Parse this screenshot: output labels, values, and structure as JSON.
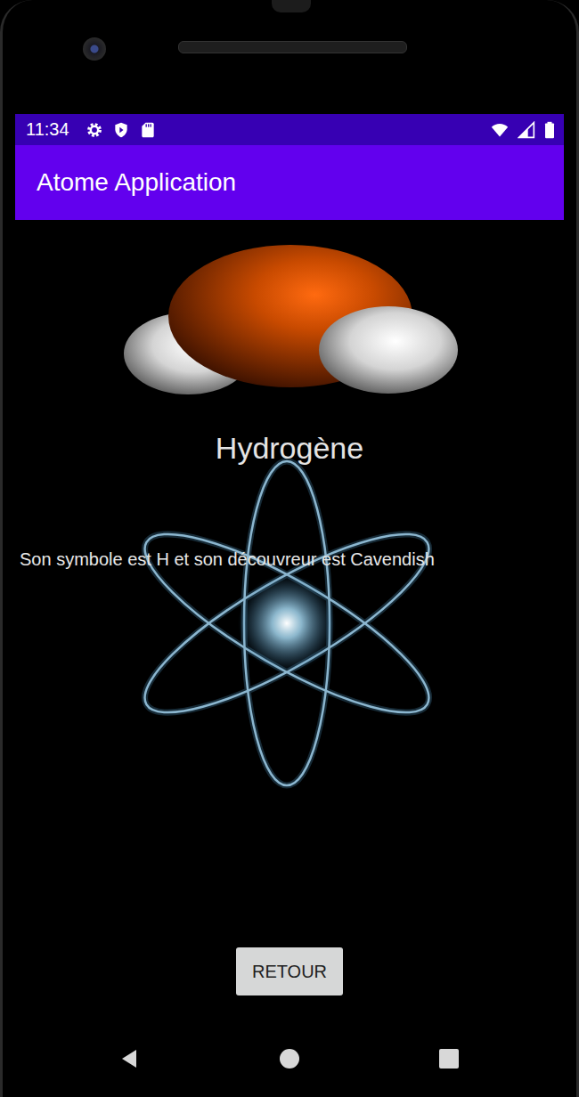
{
  "status_bar": {
    "time": "11:34"
  },
  "app_bar": {
    "title": "Atome Application"
  },
  "element": {
    "name": "Hydrogène",
    "description": "Son symbole est H et son découvreur est Cavendish"
  },
  "buttons": [
    "RETOUR"
  ]
}
